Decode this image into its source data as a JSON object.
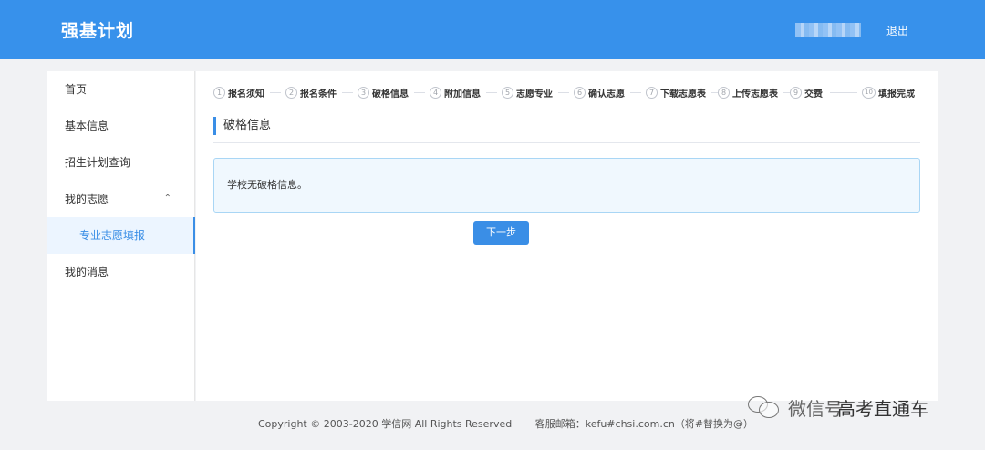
{
  "header": {
    "title": "强基计划",
    "logout_label": "退出"
  },
  "sidebar": {
    "items": [
      {
        "label": "首页"
      },
      {
        "label": "基本信息"
      },
      {
        "label": "招生计划查询"
      },
      {
        "label": "我的志愿",
        "expand_icon": "chevron-up-icon"
      },
      {
        "label": "专业志愿填报",
        "active": true
      },
      {
        "label": "我的消息"
      }
    ]
  },
  "steps": [
    {
      "num": "1",
      "label": "报名须知"
    },
    {
      "num": "2",
      "label": "报名条件"
    },
    {
      "num": "3",
      "label": "破格信息"
    },
    {
      "num": "4",
      "label": "附加信息"
    },
    {
      "num": "5",
      "label": "志愿专业"
    },
    {
      "num": "6",
      "label": "确认志愿"
    },
    {
      "num": "7",
      "label": "下载志愿表"
    },
    {
      "num": "8",
      "label": "上传志愿表"
    },
    {
      "num": "9",
      "label": "交费"
    },
    {
      "num": "10",
      "label": "填报完成"
    }
  ],
  "section": {
    "title": "破格信息",
    "notice": "学校无破格信息。",
    "next_label": "下一步"
  },
  "footer": {
    "copyright": "Copyright © 2003-2020 学信网 All Rights Reserved",
    "contact": "客服邮箱：kefu#chsi.com.cn（将#替换为@）"
  },
  "watermark": {
    "text1": "微信号",
    "text2": "高考直通车"
  },
  "colors": {
    "header_bg": "#3791eb",
    "accent": "#3a8ee6",
    "notice_bg": "#f0f8fe"
  }
}
